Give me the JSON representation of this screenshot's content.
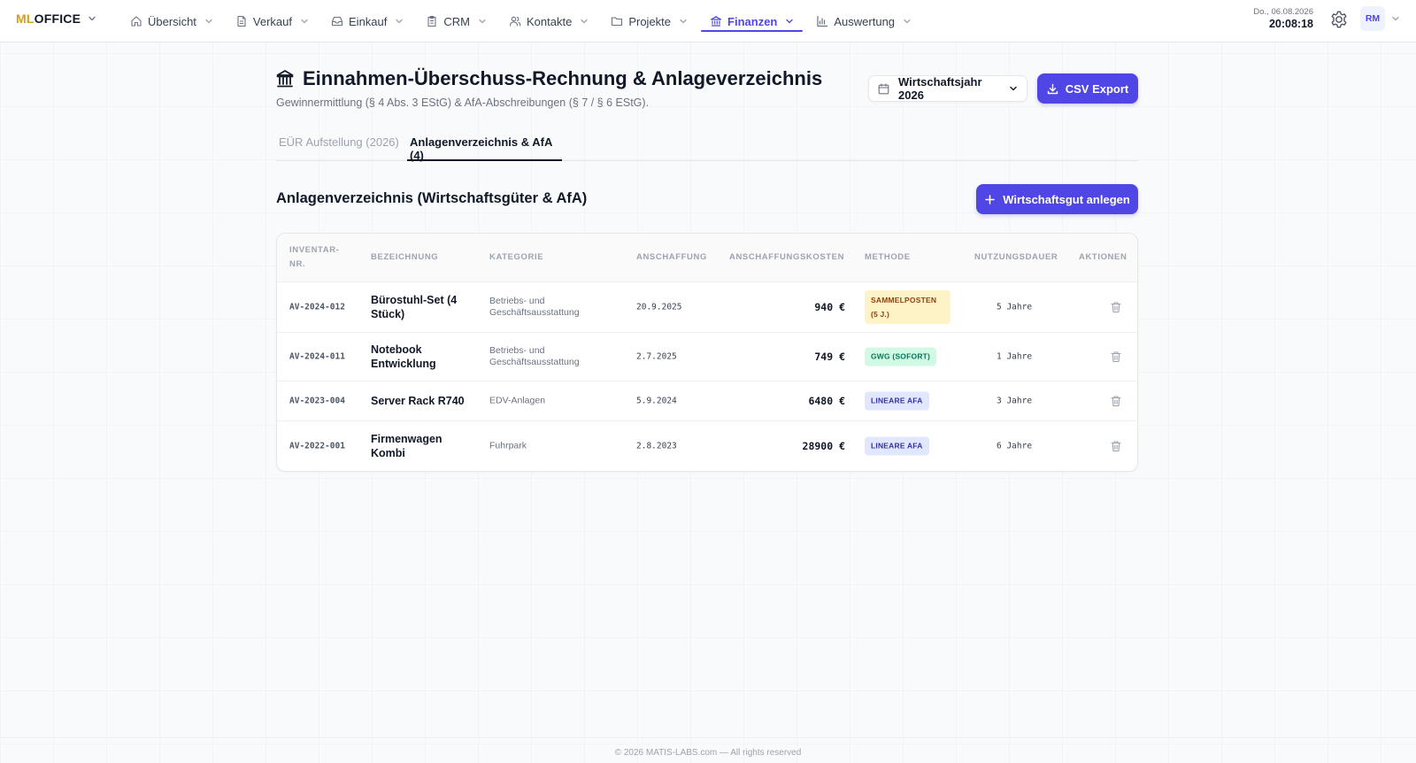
{
  "app": {
    "logo_ml": "ML",
    "logo_office": "OFFICE"
  },
  "nav": {
    "items": [
      {
        "label": "Übersicht",
        "icon": "home-icon",
        "active": false
      },
      {
        "label": "Verkauf",
        "icon": "file-icon",
        "active": false
      },
      {
        "label": "Einkauf",
        "icon": "inbox-icon",
        "active": false
      },
      {
        "label": "CRM",
        "icon": "clipboard-icon",
        "active": false
      },
      {
        "label": "Kontakte",
        "icon": "users-icon",
        "active": false
      },
      {
        "label": "Projekte",
        "icon": "folder-icon",
        "active": false
      },
      {
        "label": "Finanzen",
        "icon": "bank-icon",
        "active": true
      },
      {
        "label": "Auswertung",
        "icon": "bar-chart-icon",
        "active": false
      }
    ],
    "date": "Do., 06.08.2026",
    "time": "20:08:18",
    "avatar": "RM"
  },
  "header": {
    "title": "Einnahmen-Überschuss-Rechnung & Anlageverzeichnis",
    "subtitle": "Gewinnermittlung (§ 4 Abs. 3 EStG) & AfA-Abschreibungen (§ 7 / § 6 EStG).",
    "year_select": "Wirtschaftsjahr 2026",
    "csv_button": "CSV Export"
  },
  "tabs": [
    {
      "label": "EÜR Aufstellung (2026)",
      "active": false
    },
    {
      "label": "Anlagenverzeichnis & AfA (4)",
      "active": true
    }
  ],
  "section": {
    "title": "Anlagenverzeichnis (Wirtschaftsgüter & AfA)",
    "add_button": "Wirtschaftsgut anlegen"
  },
  "table": {
    "columns": {
      "inv_line1": "Inventar-",
      "inv_line2": "Nr.",
      "name": "Bezeichnung",
      "category": "Kategorie",
      "acquired": "Anschaffung",
      "cost": "Anschaffungskosten",
      "method": "Methode",
      "duration": "Nutzungsdauer",
      "actions": "Aktionen"
    },
    "rows": [
      {
        "inv": "AV-2024-012",
        "name": "Bürostuhl-Set (4 Stück)",
        "category": "Betriebs- und Geschäftsausstattung",
        "acquired": "20.9.2025",
        "cost": "940 €",
        "method": "Sammelposten (5 J.)",
        "method_color": "#fef3c7",
        "duration": "5 Jahre"
      },
      {
        "inv": "AV-2024-011",
        "name": "Notebook Entwicklung",
        "category": "Betriebs- und Geschäftsausstattung",
        "acquired": "2.7.2025",
        "cost": "749 €",
        "method": "GWG (Sofort)",
        "method_color": "#d1fae5",
        "duration": "1 Jahre"
      },
      {
        "inv": "AV-2023-004",
        "name": "Server Rack R740",
        "category": "EDV-Anlagen",
        "acquired": "5.9.2024",
        "cost": "6480 €",
        "method": "Lineare AfA",
        "method_color": "#e0e7ff",
        "duration": "3 Jahre"
      },
      {
        "inv": "AV-2022-001",
        "name": "Firmenwagen Kombi",
        "category": "Fuhrpark",
        "acquired": "2.8.2023",
        "cost": "28900 €",
        "method": "Lineare AfA",
        "method_color": "#e0e7ff",
        "duration": "6 Jahre"
      }
    ]
  },
  "footer": {
    "text": "© 2026 MATIS-LABS.com — All rights reserved"
  },
  "colors": {
    "accent": "#4f46e5",
    "logo_ml": "#d4a017"
  }
}
